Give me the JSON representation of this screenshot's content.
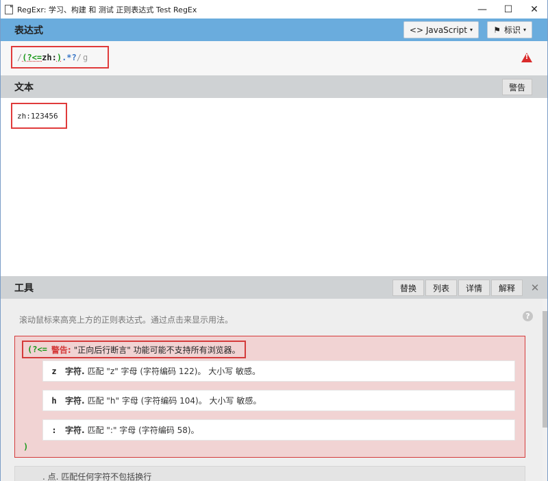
{
  "window": {
    "title": "RegExr: 学习、构建 和 测试 正则表达式 Test RegEx",
    "minimize": "—",
    "maximize": "☐",
    "close": "✕"
  },
  "expression_panel": {
    "title": "表达式",
    "flavor_button": "<> JavaScript",
    "flags_button": "标识",
    "caret": "▾",
    "regex": {
      "open_slash": "/",
      "lookbehind": "(?<=",
      "literal": "zh:",
      "close_paren": ")",
      "any": ".*?",
      "close_slash": "/",
      "flag": "g"
    }
  },
  "text_panel": {
    "title": "文本",
    "alert_button": "警告",
    "content": "zh:123456"
  },
  "tools_panel": {
    "title": "工具",
    "tabs": [
      "替换",
      "列表",
      "详情",
      "解释"
    ],
    "close": "✕",
    "hint": "滚动鼠标来高亮上方的正则表达式。通过点击来显示用法。",
    "help": "?",
    "explain": {
      "warn_token": "(?<=",
      "warn_label": "警告:",
      "warn_message": "\"正向后行断言\" 功能可能不支持所有浏览器。",
      "rows": [
        {
          "token": "z",
          "bold": "字符.",
          "desc": "匹配 \"z\" 字母 (字符编码 122)。 大小写 敏感。"
        },
        {
          "token": "h",
          "bold": "字符.",
          "desc": "匹配 \"h\" 字母 (字符编码 104)。 大小写 敏感。"
        },
        {
          "token": ":",
          "bold": "字符.",
          "desc": "匹配 \":\" 字母 (字符编码 58)。"
        }
      ],
      "close_paren": ")"
    },
    "dot_row": ". 点. 匹配任何字符不包括换行"
  }
}
